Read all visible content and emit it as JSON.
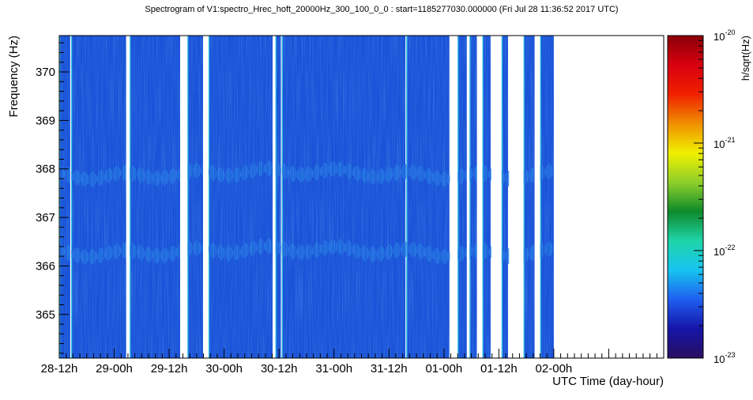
{
  "chart_data": {
    "type": "heatmap",
    "title": "Spectrogram of V1:spectro_Hrec_hoft_20000Hz_300_100_0_0 : start=1185277030.000000 (Fri Jul 28 11:36:52 2017 UTC)",
    "xlabel": "UTC Time (day-hour)",
    "ylabel": "Frequency (Hz)",
    "zlabel": "h/sqrt(Hz)",
    "x_unit": "hours since start",
    "xlim": [
      0,
      132
    ],
    "ylim": [
      364.1,
      370.75
    ],
    "x_ticks": [
      {
        "label": "28-12h",
        "value": 0
      },
      {
        "label": "29-00h",
        "value": 12
      },
      {
        "label": "29-12h",
        "value": 24
      },
      {
        "label": "30-00h",
        "value": 36
      },
      {
        "label": "30-12h",
        "value": 48
      },
      {
        "label": "31-00h",
        "value": 60
      },
      {
        "label": "31-12h",
        "value": 72
      },
      {
        "label": "01-00h",
        "value": 84
      },
      {
        "label": "01-12h",
        "value": 96
      },
      {
        "label": "02-00h",
        "value": 108
      }
    ],
    "y_ticks": [
      365,
      366,
      367,
      368,
      369,
      370
    ],
    "colorbar": {
      "scale": "log",
      "range_exponents": [
        -23,
        -20
      ],
      "ticks": [
        {
          "base": "10",
          "exp": "-20",
          "value": -20
        },
        {
          "base": "10",
          "exp": "-21",
          "value": -21
        },
        {
          "base": "10",
          "exp": "-22",
          "value": -22
        },
        {
          "base": "10",
          "exp": "-23",
          "value": -23
        }
      ],
      "colors": [
        "#2a0f60",
        "#1515a8",
        "#1f5ef0",
        "#17c4f0",
        "#1fd4a8",
        "#0e8a2a",
        "#8fcf2a",
        "#f0f000",
        "#f09000",
        "#f02000",
        "#d80010",
        "#8a0008"
      ]
    },
    "colors": {
      "background_level": "#1a52d8",
      "feature_level": "#2a86e6",
      "gap": "#ffffff",
      "edge_highlight": "#2fe0e6"
    },
    "data_segments_hours": [
      [
        0,
        2.4
      ],
      [
        2.6,
        14.6
      ],
      [
        15.4,
        26.4
      ],
      [
        28.0,
        31.4
      ],
      [
        32.6,
        46.6
      ],
      [
        47.2,
        48.4
      ],
      [
        48.6,
        75.6
      ],
      [
        75.8,
        85.2
      ],
      [
        87.0,
        89.0
      ],
      [
        89.6,
        91.2
      ],
      [
        92.4,
        94.2
      ],
      [
        96.6,
        98.0
      ],
      [
        101.4,
        103.8
      ],
      [
        105.0,
        108.0
      ]
    ],
    "features": [
      {
        "name": "line",
        "frequency_hz": 367.9,
        "level_exponent": -22.5
      },
      {
        "name": "line",
        "frequency_hz": 366.3,
        "level_exponent": -22.5
      }
    ],
    "background_level_exponent": -22.7
  }
}
